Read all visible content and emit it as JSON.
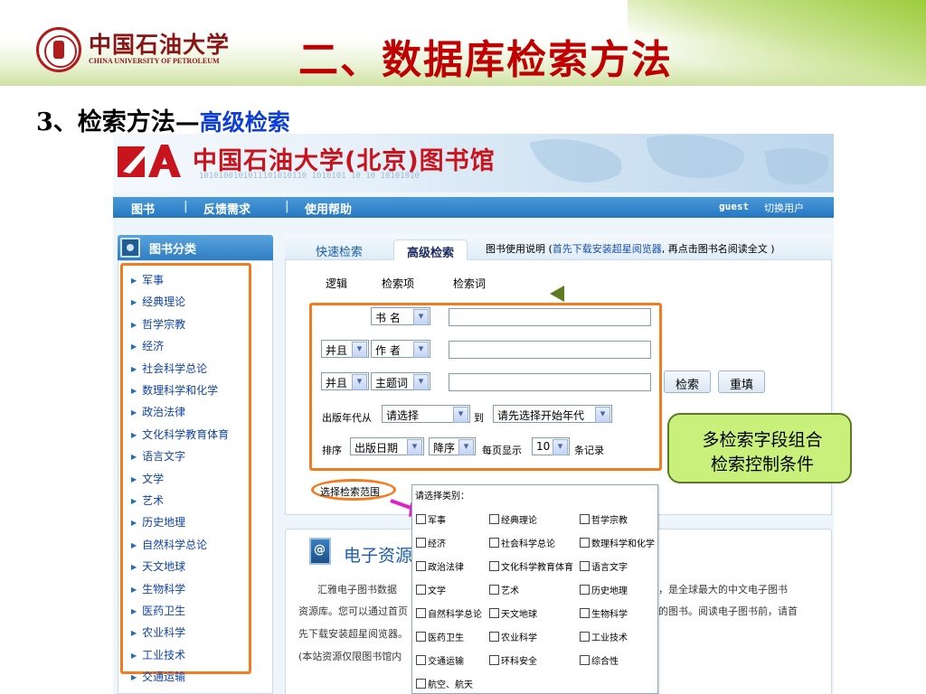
{
  "slide": {
    "logo_cn": "中国石油大学",
    "logo_en": "CHINA UNIVERSITY OF PETROLEUM",
    "title": "二、数据库检索方法",
    "subtitle_prefix": "3、检索方法—",
    "subtitle_highlight": "高级检索"
  },
  "site": {
    "banner_title": "中国石油大学(北京)图书馆",
    "banner_digits": "1010100101011101010110    1010101   10 10 10101010",
    "nav": {
      "books": "图书",
      "feedback": "反馈需求",
      "help": "使用帮助",
      "guest": "guest",
      "switch_user": "切换用户",
      "separator": "|"
    },
    "sidebar": {
      "header": "图书分类",
      "items": [
        "军事",
        "经典理论",
        "哲学宗教",
        "经济",
        "社会科学总论",
        "数理科学和化学",
        "政治法律",
        "文化科学教育体育",
        "语言文字",
        "文学",
        "艺术",
        "历史地理",
        "自然科学总论",
        "天文地球",
        "生物科学",
        "医药卫生",
        "农业科学",
        "工业技术",
        "交通运输"
      ]
    },
    "tabs": {
      "quick": "快速检索",
      "advanced": "高级检索",
      "note_prefix": "图书使用说明 (",
      "note_blue": "首先下载安装超星阅览器",
      "note_suffix": ", 再点击图书名阅读全文 )"
    },
    "form": {
      "col_logic": "逻辑",
      "col_field": "检索项",
      "col_word": "检索词",
      "rows": [
        {
          "logic": "",
          "field": "书 名"
        },
        {
          "logic": "并且",
          "field": "作 者"
        },
        {
          "logic": "并且",
          "field": "主题词"
        }
      ],
      "search_button": "检索",
      "reset_button": "重填",
      "year_label": "出版年代从",
      "year_from": "请选择",
      "year_to_label": "到",
      "year_to": "请先选择开始年代",
      "sort_label": "排序",
      "sort_field": "出版日期",
      "sort_order": "降序",
      "per_page_label": "每页显示",
      "per_page": "10",
      "per_page_unit": "条记录",
      "scope_link": "选择检索范围"
    },
    "callout": {
      "line1": "多检索字段组合",
      "line2": "检索控制条件"
    },
    "eresource": {
      "title": "电子资源",
      "lines": [
        "汇雅电子图书数据",
        "资源库。您可以通过首页",
        "先下载安装超星阅览器。",
        "(本站资源仅限图书馆内"
      ],
      "right_lines": [
        "类，是全球最大的中文电子图书",
        "籍的图书。阅读电子图书前，请首"
      ]
    },
    "popup": {
      "header": "请选择类别：",
      "categories": [
        "军事",
        "经典理论",
        "哲学宗教",
        "经济",
        "社会科学总论",
        "数理科学和化学",
        "政治法律",
        "文化科学教育体育",
        "语言文字",
        "文学",
        "艺术",
        "历史地理",
        "自然科学总论",
        "天文地球",
        "生物科学",
        "医药卫生",
        "农业科学",
        "工业技术",
        "交通运输",
        "环科安全",
        "综合性",
        "航空、航天"
      ]
    }
  },
  "colors": {
    "title_red": "#c00000",
    "subtitle_blue": "#0d3fd6",
    "highlight_orange": "#f47c20",
    "callout_green": "#c8f07a",
    "nav_blue": "#2677c2",
    "arrow_magenta": "#e020c8"
  }
}
